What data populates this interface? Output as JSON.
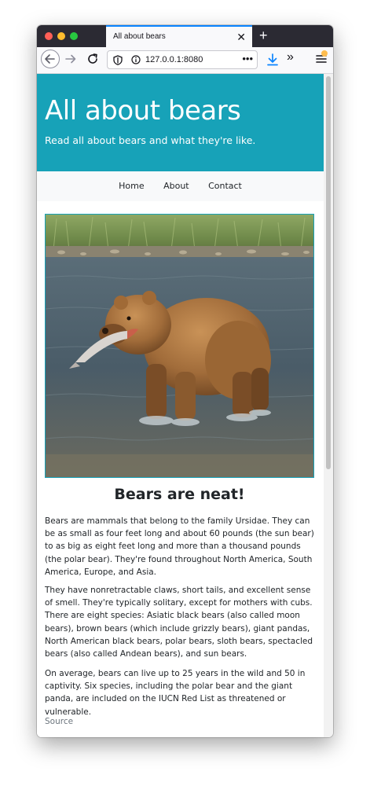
{
  "browser": {
    "tab_title": "All about bears",
    "tab_close": "✕",
    "new_tab": "+",
    "url": "127.0.0.1:8080",
    "url_more": "•••",
    "overflow": "»"
  },
  "page": {
    "header": {
      "title": "All about bears",
      "tagline": "Read all about bears and what they're like.",
      "bg_color": "#17a2b8"
    },
    "nav": {
      "items": [
        "Home",
        "About",
        "Contact"
      ]
    },
    "image": {
      "subject": "brown bear holding a salmon in its mouth, standing in a river"
    },
    "heading": "Bears are neat!",
    "paragraphs": [
      "Bears are mammals that belong to the family Ursidae. They can be as small as four feet long and about 60 pounds (the sun bear) to as big as eight feet long and more than a thousand pounds (the polar bear). They're found throughout North America, South America, Europe, and Asia.",
      "They have nonretractable claws, short tails, and excellent sense of smell. They're typically solitary, except for mothers with cubs. There are eight species: Asiatic black bears (also called moon bears), brown bears (which include grizzly bears), giant pandas, North American black bears, polar bears, sloth bears, spectacled bears (also called Andean bears), and sun bears.",
      "On average, bears can live up to 25 years in the wild and 50 in captivity. Six species, including the polar bear and the giant panda, are included on the IUCN Red List as threatened or vulnerable."
    ],
    "source_link": "Source"
  }
}
